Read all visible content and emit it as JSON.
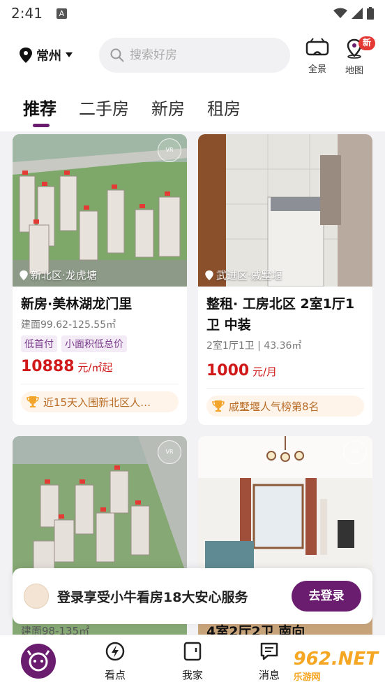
{
  "status_bar": {
    "time": "2:41",
    "app_badge": "A"
  },
  "header": {
    "city": "常州",
    "search_placeholder": "搜索好房",
    "actions": [
      {
        "label": "全景",
        "icon": "vr-headset-icon"
      },
      {
        "label": "地图",
        "icon": "map-pin-icon",
        "badge": "新"
      }
    ]
  },
  "tabs": [
    {
      "label": "推荐",
      "active": true
    },
    {
      "label": "二手房",
      "active": false
    },
    {
      "label": "新房",
      "active": false
    },
    {
      "label": "租房",
      "active": false
    }
  ],
  "listings": [
    {
      "location": "新北区·龙虎塘",
      "title": "新房·美林湖龙门里",
      "sub": "建面99.62-125.55㎡",
      "tags": [
        "低首付",
        "小面积低总价"
      ],
      "price_value": "10888",
      "price_unit": " 元/㎡起",
      "rank": "近15天入围新北区人…"
    },
    {
      "location": "武进区·戚墅堰",
      "title": "整租· 工房北区 2室1厅1卫 中装",
      "sub": "2室1厅1卫 | 43.36㎡",
      "tags": [],
      "price_value": "1000",
      "price_unit": " 元/月",
      "rank": "戚墅堰人气榜第8名"
    }
  ],
  "peek": {
    "left_sub": "建面98-135㎡",
    "right_title": "4室2厅2卫 南向"
  },
  "login_banner": {
    "text": "登录享受小牛看房18大安心服务",
    "button": "去登录"
  },
  "bottom_nav": [
    {
      "label": "",
      "icon": "home-logo-icon"
    },
    {
      "label": "看点",
      "icon": "lightning-icon"
    },
    {
      "label": "我家",
      "icon": "house-icon"
    },
    {
      "label": "消息",
      "icon": "message-icon"
    }
  ],
  "watermark": {
    "brand": "962.NET",
    "sub": "乐游网"
  },
  "colors": {
    "brand": "#6a1c6e",
    "price": "#d01818",
    "tag_bg": "#f3ecf6",
    "rank_bg": "#fff4ea"
  }
}
